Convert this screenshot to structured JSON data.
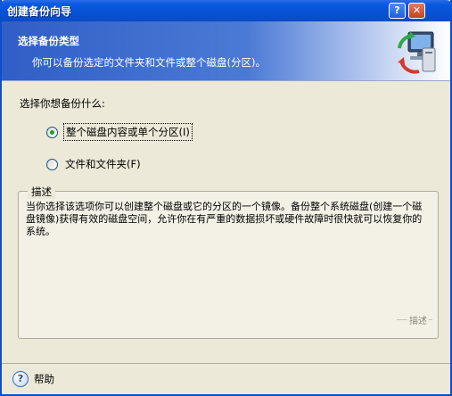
{
  "window": {
    "title": "创建备份向导",
    "help_button": "?",
    "close_button": "✕"
  },
  "header": {
    "heading": "选择备份类型",
    "subheading": "你可以备份选定的文件夹和文件或整个磁盘(分区)。",
    "icon": "backup-computer-icon"
  },
  "question": "选择你想备份什么:",
  "options": [
    {
      "label": "整个磁盘内容或单个分区(I)",
      "selected": true
    },
    {
      "label": "文件和文件夹(F)",
      "selected": false
    }
  ],
  "description": {
    "title": "描述",
    "text": "当你选择该选项你可以创建整个磁盘或它的分区的一个镜像。备份整个系统磁盘(创建一个磁盘镜像)获得有效的磁盘空间，允许你在有严重的数据损坏或硬件故障时很快就可以恢复你的系统。",
    "footer": "描述"
  },
  "footer": {
    "help_label": "帮助",
    "help_icon": "help-icon"
  }
}
